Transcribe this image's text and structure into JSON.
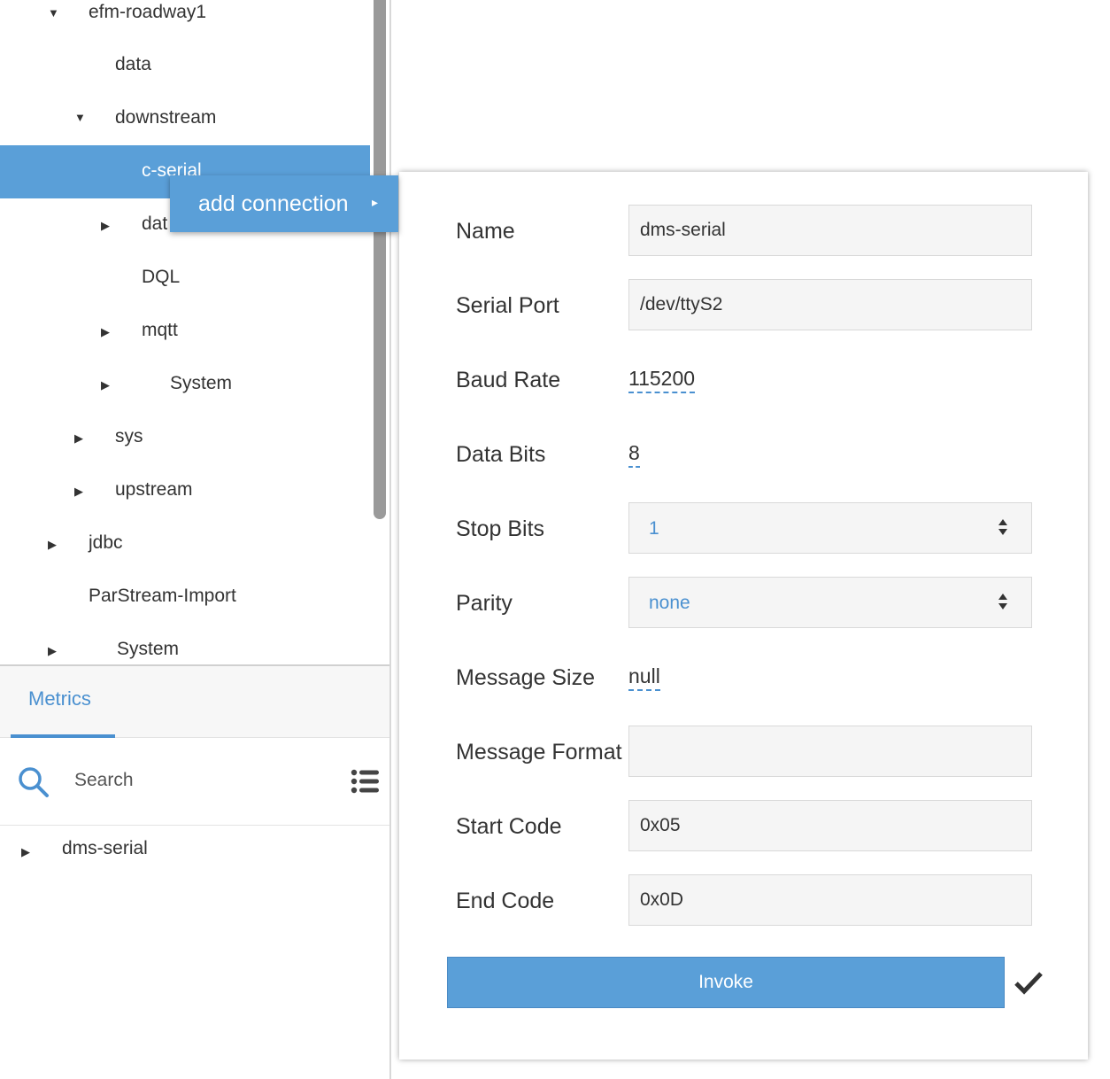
{
  "tree": {
    "items": [
      {
        "label": "efm-roadway1",
        "arrow": "▼"
      },
      {
        "label": "data",
        "arrow": ""
      },
      {
        "label": "downstream",
        "arrow": "▼"
      },
      {
        "label": "c-serial",
        "arrow": ""
      },
      {
        "label": "dat",
        "arrow": "▶"
      },
      {
        "label": "DQL",
        "arrow": ""
      },
      {
        "label": "mqtt",
        "arrow": "▶"
      },
      {
        "label": "System",
        "arrow": "▶"
      },
      {
        "label": "sys",
        "arrow": "▶"
      },
      {
        "label": "upstream",
        "arrow": "▶"
      },
      {
        "label": "jdbc",
        "arrow": "▶"
      },
      {
        "label": "ParStream-Import",
        "arrow": ""
      },
      {
        "label": "System",
        "arrow": "▶"
      }
    ]
  },
  "context_menu": {
    "label": "add connection",
    "arrow": "▸"
  },
  "metrics": {
    "tab_label": "Metrics",
    "search_placeholder": "Search",
    "items": [
      {
        "label": "dms-serial",
        "arrow": "▶"
      }
    ]
  },
  "dialog": {
    "fields": {
      "name": {
        "label": "Name",
        "value": "dms-serial"
      },
      "serial_port": {
        "label": "Serial Port",
        "value": "/dev/ttyS2"
      },
      "baud_rate": {
        "label": "Baud Rate",
        "value": "115200"
      },
      "data_bits": {
        "label": "Data Bits",
        "value": "8"
      },
      "stop_bits": {
        "label": "Stop Bits",
        "value": "1"
      },
      "parity": {
        "label": "Parity",
        "value": "none"
      },
      "message_size": {
        "label": "Message Size",
        "value": "null"
      },
      "message_format": {
        "label": "Message Format",
        "value": ""
      },
      "start_code": {
        "label": "Start Code",
        "value": "0x05"
      },
      "end_code": {
        "label": "End Code",
        "value": "0x0D"
      }
    },
    "invoke_label": "Invoke"
  },
  "colors": {
    "accent": "#5a9fd8",
    "link": "#4a90d0"
  }
}
